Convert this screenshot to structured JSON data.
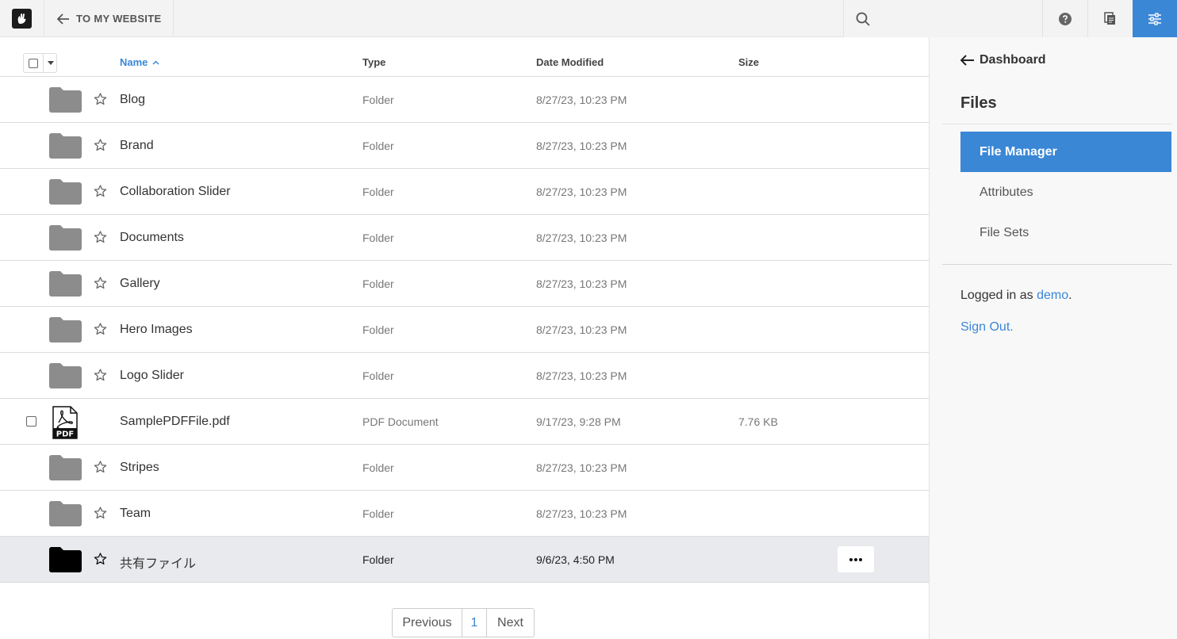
{
  "topbar": {
    "back_label": "TO MY WEBSITE",
    "search_placeholder": ""
  },
  "table": {
    "headers": {
      "name": "Name",
      "type": "Type",
      "date": "Date Modified",
      "size": "Size"
    },
    "rows": [
      {
        "name": "Blog",
        "type": "Folder",
        "date": "8/27/23, 10:23 PM",
        "size": "",
        "kind": "folder"
      },
      {
        "name": "Brand",
        "type": "Folder",
        "date": "8/27/23, 10:23 PM",
        "size": "",
        "kind": "folder"
      },
      {
        "name": "Collaboration Slider",
        "type": "Folder",
        "date": "8/27/23, 10:23 PM",
        "size": "",
        "kind": "folder"
      },
      {
        "name": "Documents",
        "type": "Folder",
        "date": "8/27/23, 10:23 PM",
        "size": "",
        "kind": "folder"
      },
      {
        "name": "Gallery",
        "type": "Folder",
        "date": "8/27/23, 10:23 PM",
        "size": "",
        "kind": "folder"
      },
      {
        "name": "Hero Images",
        "type": "Folder",
        "date": "8/27/23, 10:23 PM",
        "size": "",
        "kind": "folder"
      },
      {
        "name": "Logo Slider",
        "type": "Folder",
        "date": "8/27/23, 10:23 PM",
        "size": "",
        "kind": "folder"
      },
      {
        "name": "SamplePDFFile.pdf",
        "type": "PDF Document",
        "date": "9/17/23, 9:28 PM",
        "size": "7.76 KB",
        "kind": "pdf"
      },
      {
        "name": "Stripes",
        "type": "Folder",
        "date": "8/27/23, 10:23 PM",
        "size": "",
        "kind": "folder"
      },
      {
        "name": "Team",
        "type": "Folder",
        "date": "8/27/23, 10:23 PM",
        "size": "",
        "kind": "folder"
      },
      {
        "name": "共有ファイル",
        "type": "Folder",
        "date": "9/6/23, 4:50 PM",
        "size": "",
        "kind": "folder-dark"
      }
    ]
  },
  "pager": {
    "prev": "Previous",
    "page": "1",
    "next": "Next"
  },
  "panel": {
    "back_label": "Dashboard",
    "title": "Files",
    "nav": [
      "File Manager",
      "Attributes",
      "File Sets"
    ],
    "logged_prefix": "Logged in as ",
    "user": "demo",
    "logged_suffix": ".",
    "signout": "Sign Out."
  },
  "colors": {
    "accent": "#3a87d6",
    "folder": "#8c8c8c",
    "highlight_row": "#e8eaed"
  }
}
